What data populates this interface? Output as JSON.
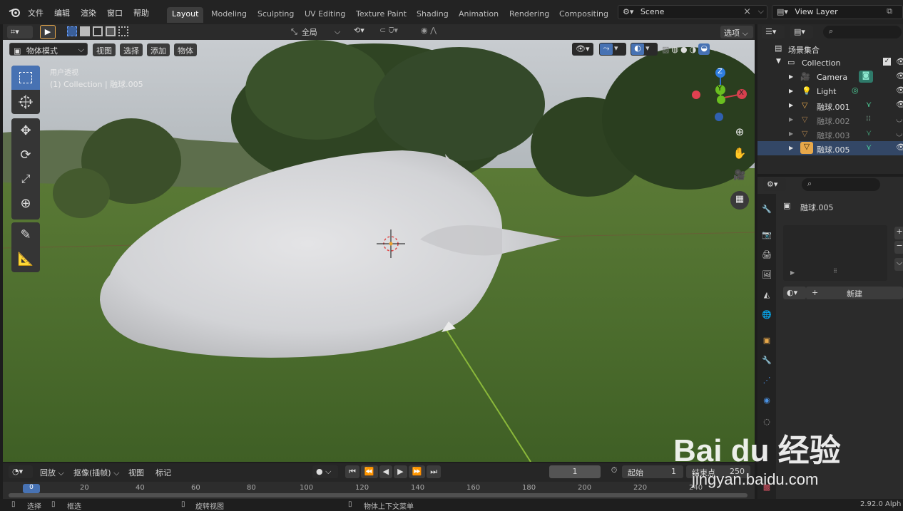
{
  "menus": [
    "文件",
    "编辑",
    "渲染",
    "窗口",
    "帮助"
  ],
  "workspaces": [
    "Layout",
    "Modeling",
    "Sculpting",
    "UV Editing",
    "Texture Paint",
    "Shading",
    "Animation",
    "Rendering",
    "Compositing"
  ],
  "active_workspace": "Layout",
  "scene": "Scene",
  "view_layer": "View Layer",
  "header": {
    "transform_orientation": "全局",
    "options": "选项",
    "mode": "物体模式",
    "view": "视图",
    "select": "选择",
    "add": "添加",
    "object": "物体"
  },
  "viewport": {
    "view_name": "用户透视",
    "object_info": "(1) Collection | 融球.005",
    "gizmo": {
      "x": "X",
      "y": "Y",
      "z": "Z"
    }
  },
  "outliner": {
    "title": "场景集合",
    "items": [
      {
        "label": "Collection",
        "icon": "collection-icon"
      },
      {
        "label": "Camera",
        "icon": "camera-icon"
      },
      {
        "label": "Light",
        "icon": "light-icon"
      },
      {
        "label": "融球.001",
        "icon": "metaball-icon"
      },
      {
        "label": "融球.002",
        "icon": "metaball-icon"
      },
      {
        "label": "融球.003",
        "icon": "metaball-icon"
      },
      {
        "label": "融球.005",
        "icon": "metaball-icon"
      }
    ]
  },
  "properties": {
    "object_name": "融球.005",
    "new_button": "新建"
  },
  "timeline": {
    "playback": "回放",
    "keying": "抠像(插帧)",
    "view": "视图",
    "marker": "标记",
    "current_frame": "1",
    "start_label": "起始",
    "start": "1",
    "end_label": "结束点",
    "end": "250",
    "ticks": [
      "0",
      "20",
      "40",
      "60",
      "80",
      "100",
      "120",
      "140",
      "160",
      "180",
      "200",
      "220",
      "240"
    ]
  },
  "status": {
    "select": "选择",
    "box_select": "框选",
    "rotate_view": "旋转视图",
    "context_menu": "物体上下文菜单",
    "version": "2.92.0 Alph"
  },
  "watermark": {
    "brand": "Bai du 经验",
    "url": "jingyan.baidu.com"
  }
}
